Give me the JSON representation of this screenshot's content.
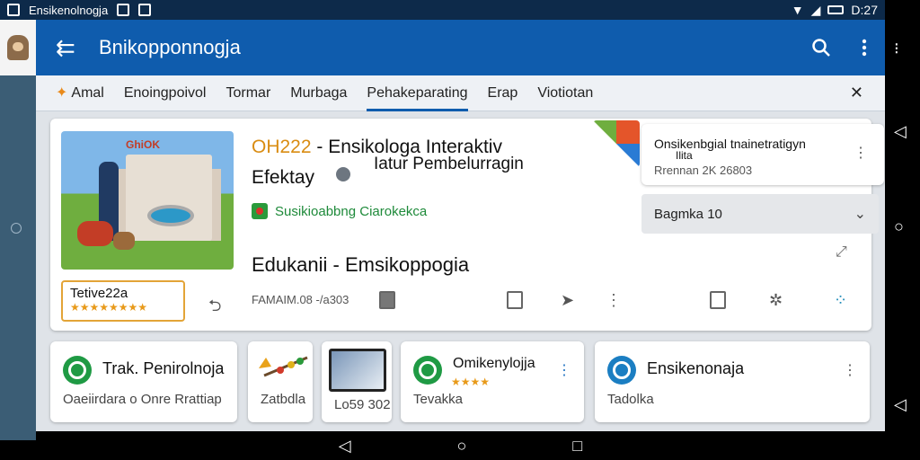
{
  "status_bar": {
    "app_name": "Ensikenolnogja",
    "time": "D:27"
  },
  "app_bar": {
    "title": "Bnikopponnogja"
  },
  "tabs": [
    {
      "label": "Amal",
      "active": false
    },
    {
      "label": "Enoingpoivol",
      "active": false
    },
    {
      "label": "Tormar",
      "active": false
    },
    {
      "label": "Murbaga",
      "active": false
    },
    {
      "label": "Pehakeparating",
      "active": true
    },
    {
      "label": "Erap",
      "active": false
    },
    {
      "label": "Viotiotan",
      "active": false
    }
  ],
  "main_card": {
    "code": "OH222",
    "title_rest": " - Ensikologa Interaktiv",
    "title_line2": "Iatur Pembelurragin",
    "subtitle": "Efektay",
    "hero_brand": "GhiOK",
    "source": "Susikioabbng Ciarokekca",
    "subject": "Edukanii - Emsikoppogia",
    "rating_label": "Tetive22a",
    "rating_stars": "★★★★★★★★",
    "meta": "FAMAIM.08 -/a303"
  },
  "side_card": {
    "line1": "Onsikenbgial tnainetratigyn",
    "line2": "Ilita",
    "line3": "Rrennan 2K 26803"
  },
  "select": {
    "value": "Bagmka 10"
  },
  "bottom_cards": [
    {
      "title": "Trak. Penirolnoja",
      "sub": "Oaeiirdara o Onre Rrattiap"
    },
    {
      "title": "",
      "sub": "Zatbdla"
    },
    {
      "title": "",
      "sub": "Lo59 302"
    },
    {
      "title": "Omikenylojja",
      "sub": "Tevakka",
      "stars": "★★★★"
    },
    {
      "title": "Ensikenonaja",
      "sub": "Tadolka"
    }
  ],
  "colors": {
    "app_bar": "#0f5cad",
    "accent_orange": "#d98c12",
    "source_green": "#1e8a3a"
  }
}
